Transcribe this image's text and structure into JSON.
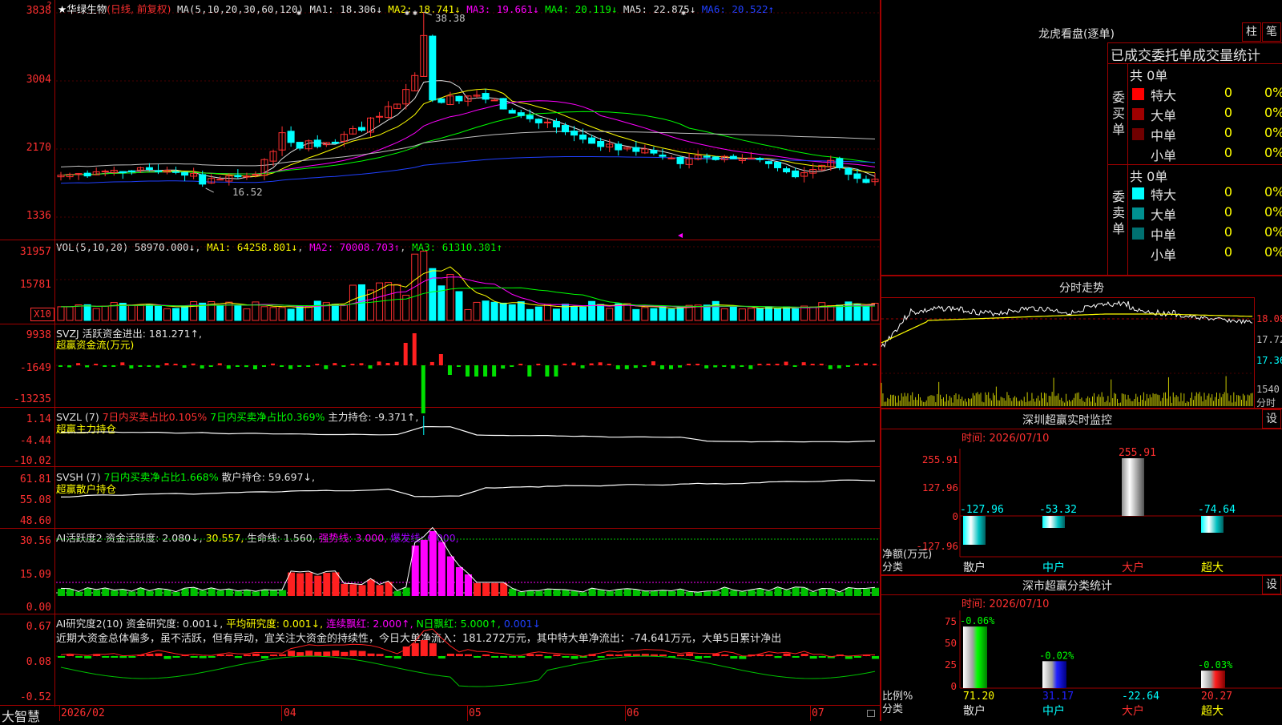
{
  "stock": {
    "star": "★",
    "name": "华绿生物",
    "mode": "(日线, 前复权)"
  },
  "price_panel": {
    "y_ticks": [
      "3838",
      "3004",
      "2170",
      "1336"
    ],
    "ma_params": "MA(5,10,20,30,60,120)",
    "ma": [
      {
        "label": "MA1: 18.306↓",
        "color": "#e0e0e0"
      },
      {
        "label": "MA2: 18.741↓",
        "color": "#ffff00"
      },
      {
        "label": "MA3: 19.661↓",
        "color": "#ff00ff"
      },
      {
        "label": "MA4: 20.119↓",
        "color": "#00ff00"
      },
      {
        "label": "MA5: 22.875↓",
        "color": "#c0c0c0"
      },
      {
        "label": "MA6: 20.522↑",
        "color": "#2040ff"
      }
    ],
    "high_label": "38.38",
    "low_label": "16.52",
    "qmark": "?"
  },
  "vol_panel": {
    "y_ticks": [
      "31957",
      "15781"
    ],
    "unit": "X10",
    "title": "VOL(5,10,20)",
    "value": "58970.000↓",
    "ma": [
      {
        "label": "MA1: 64258.801↓",
        "color": "#ffff00"
      },
      {
        "label": "MA2: 70008.703↑",
        "color": "#ff00ff"
      },
      {
        "label": "MA3: 61310.301↑",
        "color": "#00ff00"
      }
    ]
  },
  "svzj_panel": {
    "y_ticks": [
      "9938",
      "-1649",
      "-13235"
    ],
    "title": "SVZJ  活跃资金进出: 181.271↑,",
    "subtitle": "超赢资金流(万元)"
  },
  "svzl_panel": {
    "y_ticks": [
      "1.14",
      "-4.44",
      "-10.02"
    ],
    "title": "SVZL (7)",
    "t1": "7日内买卖占比0.105%",
    "t2": "7日内买卖净占比0.369%",
    "t3": "主力持仓: -9.371↑,",
    "subtitle": "超赢主力持仓"
  },
  "svsh_panel": {
    "y_ticks": [
      "61.81",
      "55.08",
      "48.60"
    ],
    "title": "SVSH (7)",
    "t1": "7日内买卖净占比1.668%",
    "t2": "散户持仓: 59.697↓,",
    "subtitle": "超赢散户持仓"
  },
  "ai1_panel": {
    "y_ticks": [
      "30.56",
      "15.09",
      "0.00"
    ],
    "title": "AI活跃度2 资金活跃度: 2.080↓,",
    "v2": "30.557,",
    "v3": "生命线: 1.560,",
    "v4": "强势线: 3.000,",
    "v5": "爆发线: 6.000,"
  },
  "ai2_panel": {
    "y_ticks": [
      "0.67",
      "0.08",
      "-0.52"
    ],
    "title": "AI研究度2(10) 资金研究度: 0.001↓,",
    "v2": "平均研究度: 0.001↓,",
    "v3": "连续飘红: 2.000↑,",
    "v4": "N日飘红: 5.000↑,",
    "v5": "0.001↓",
    "comment": "近期大资金总体偏多，虽不活跃，但有异动，宜关注大资金的持续性，今日大单净流入：181.272万元，其中特大单净流出：-74.641万元，大单5日累计净出"
  },
  "date_axis": {
    "brand": "大智慧",
    "labels": [
      "2026/02",
      "04",
      "05",
      "06",
      "07"
    ]
  },
  "longhu": {
    "title": "龙虎看盘(逐单)",
    "btn1": "柱",
    "btn2": "笔",
    "header": "已成交委托单成交量统计",
    "buy_label": "委买单",
    "sell_label": "委卖单",
    "buy_total": "共 0单",
    "sell_total": "共 0单",
    "buy_rows": [
      {
        "name": "特大",
        "vol": "0",
        "pct": "0%",
        "color": "#ff0000"
      },
      {
        "name": "大单",
        "vol": "0",
        "pct": "0%",
        "color": "#a00000"
      },
      {
        "name": "中单",
        "vol": "0",
        "pct": "0%",
        "color": "#700000"
      },
      {
        "name": "小单",
        "vol": "0",
        "pct": "0%",
        "color": "#000000"
      }
    ],
    "sell_rows": [
      {
        "name": "特大",
        "vol": "0",
        "pct": "0%",
        "color": "#00ffff"
      },
      {
        "name": "大单",
        "vol": "0",
        "pct": "0%",
        "color": "#009090"
      },
      {
        "name": "中单",
        "vol": "0",
        "pct": "0%",
        "color": "#007070"
      },
      {
        "name": "小单",
        "vol": "0",
        "pct": "0%",
        "color": "#000000"
      }
    ]
  },
  "intraday": {
    "title": "分时走势",
    "y1": "18.08",
    "y2": "17.72",
    "y3": "17.36",
    "vol": "1540",
    "vol_unit": "分时"
  },
  "sz_monitor": {
    "title": "深圳超赢实时监控",
    "btn": "设",
    "date": "时间: 2026/07/10",
    "y_top": "255.91",
    "y_mid": "127.96",
    "y_zero": "0",
    "y_neg": "-127.96",
    "ylabel1": "净额(万元)",
    "ylabel2": "分类",
    "categories": [
      "散户",
      "中户",
      "大户",
      "超大"
    ],
    "bar_labels": [
      "-127.96",
      "-53.32",
      "255.91",
      "-74.64"
    ]
  },
  "sz_class": {
    "title": "深市超赢分类统计",
    "btn": "设",
    "date": "时间: 2026/07/10",
    "y_ticks": [
      "75",
      "50",
      "25",
      "0"
    ],
    "ylabel1": "比例%",
    "ylabel2": "分类",
    "categories": [
      "散户",
      "中户",
      "大户",
      "超大"
    ],
    "top_labels": [
      "-0.06%",
      "-0.02%",
      "",
      "-0.03%"
    ],
    "bottom_labels": [
      "71.20",
      "31.17",
      "-22.64",
      "20.27"
    ]
  },
  "chart_data": {
    "type": "candlestick",
    "x_labels": [
      "2026/02",
      "04",
      "05",
      "06",
      "07"
    ],
    "ylim": [
      13.36,
      38.38
    ],
    "price_close": [
      18.4,
      18.5,
      18.6,
      18.3,
      18.8,
      18.9,
      19.0,
      18.7,
      18.8,
      19.3,
      19.1,
      18.9,
      19.0,
      18.8,
      18.4,
      18.6,
      17.3,
      18.0,
      17.9,
      18.3,
      18.2,
      18.3,
      18.5,
      20.3,
      21.3,
      23.6,
      22.4,
      21.7,
      22.6,
      21.9,
      22.4,
      22.3,
      23.4,
      24.1,
      23.9,
      25.4,
      25.6,
      26.8,
      27.1,
      28.9,
      30.6,
      35.5,
      27.6,
      27.3,
      28.1,
      27.5,
      28.1,
      28.2,
      27.7,
      27.6,
      26.5,
      26.0,
      25.7,
      25.3,
      24.8,
      24.9,
      24.3,
      23.7,
      23.3,
      22.8,
      22.3,
      21.9,
      22.2,
      21.5,
      21.8,
      21.3,
      21.6,
      21.1,
      20.7,
      20.5,
      19.8,
      20.4,
      20.8,
      20.6,
      20.3,
      20.7,
      20.4,
      20.4,
      20.5,
      20.3,
      19.8,
      19.3,
      18.8,
      18.2,
      18.7,
      19.1,
      19.6,
      20.2,
      19.3,
      18.5,
      18.0,
      17.5,
      17.9
    ],
    "ma": {
      "MA1": 18.306,
      "MA2": 18.741,
      "MA3": 19.661,
      "MA4": 20.119,
      "MA5": 22.875,
      "MA6": 20.522
    }
  }
}
